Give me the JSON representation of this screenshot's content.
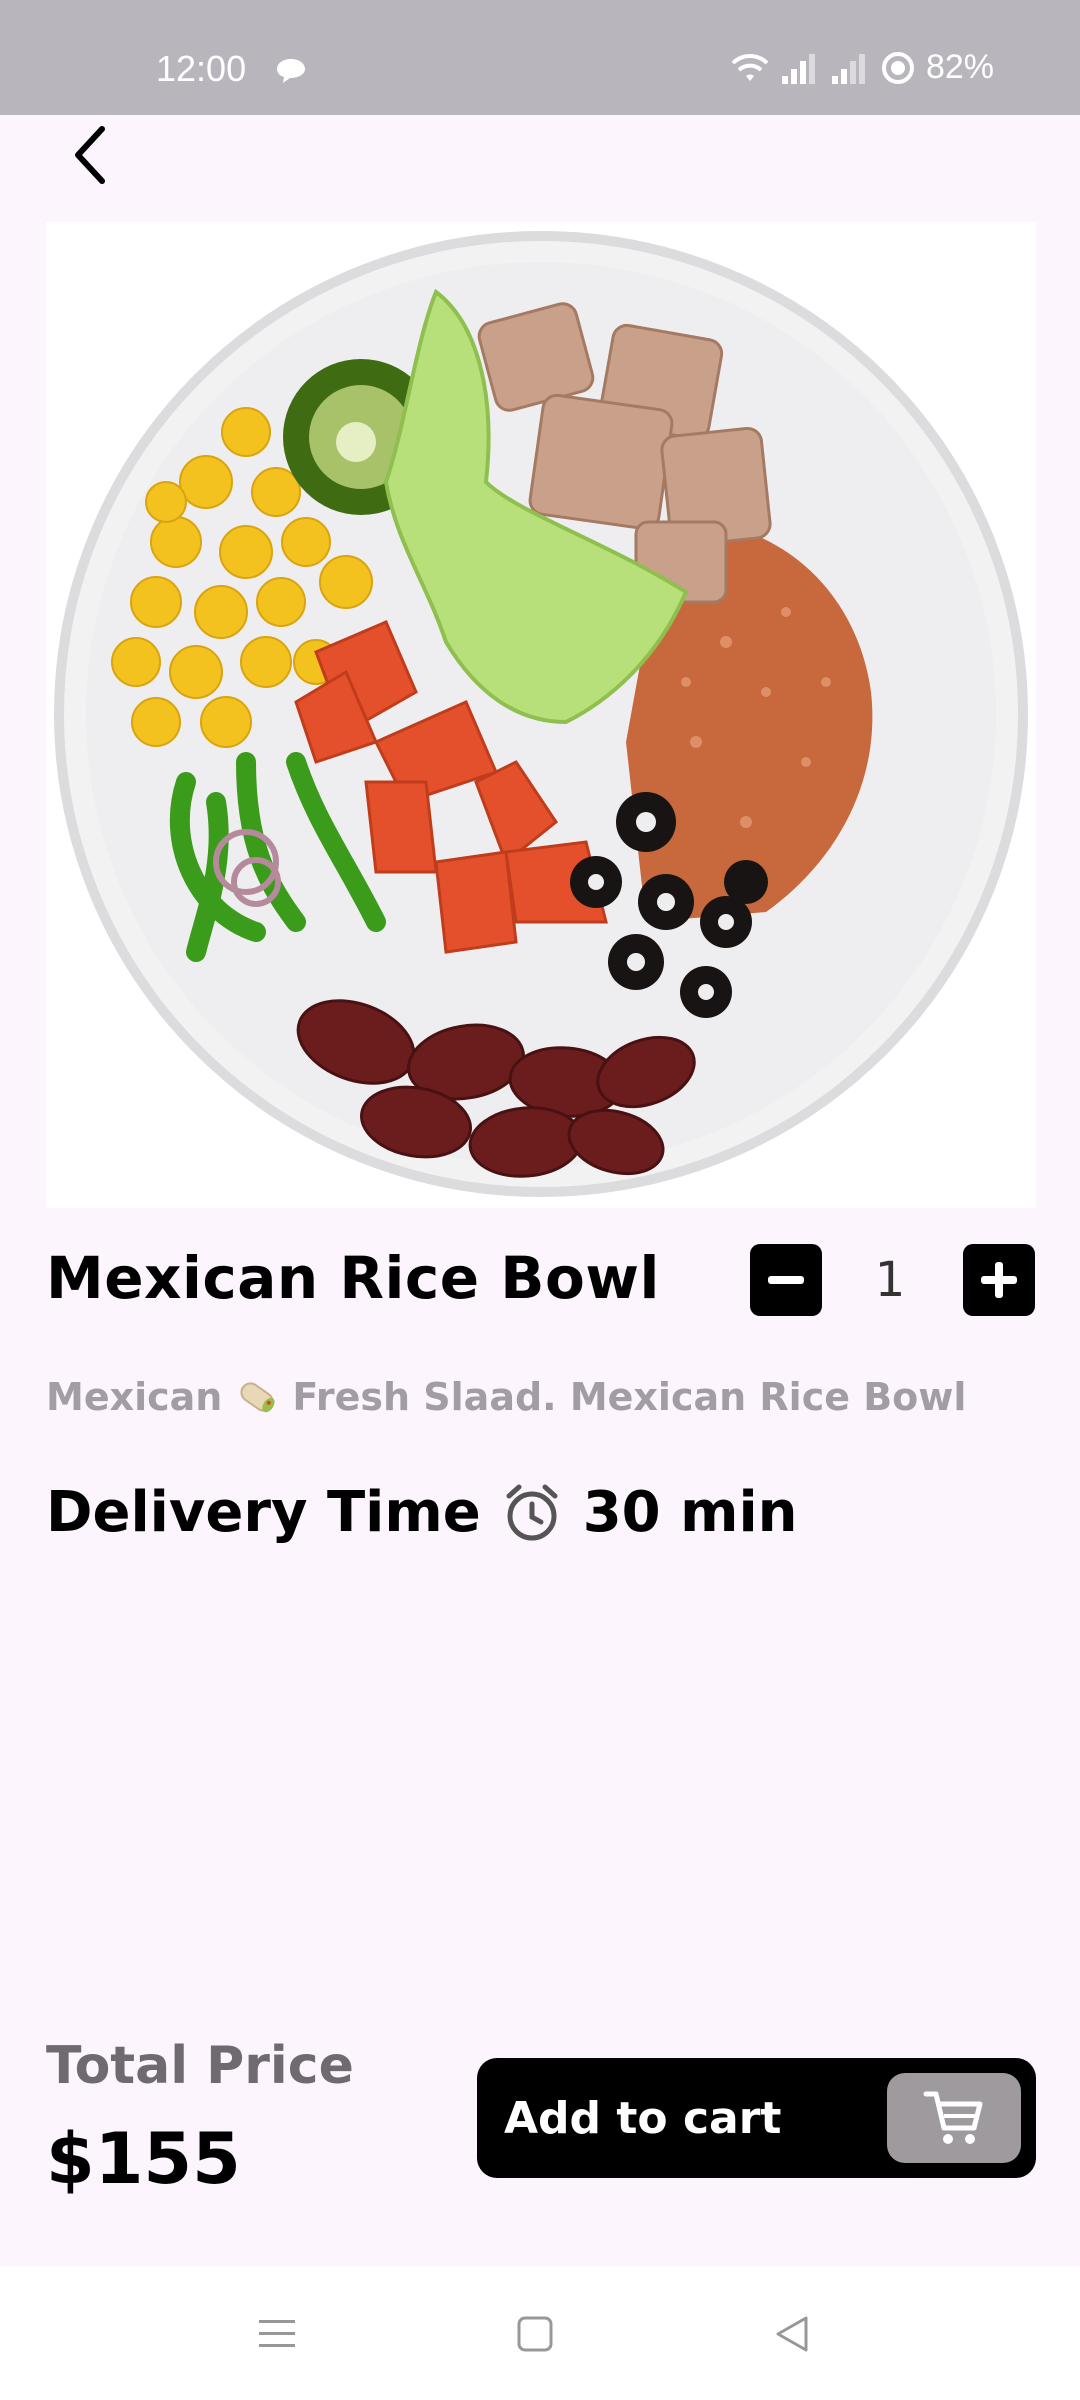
{
  "status_bar": {
    "time": "12:00",
    "battery": "82%"
  },
  "header": {
    "back_icon": "chevron-left-icon"
  },
  "product": {
    "image_alt": "bowl with rice, chicken, corn, jalapeños, lettuce, tomatoes, olives and kidney beans",
    "title": "Mexican Rice Bowl",
    "quantity": "1",
    "description_prefix": "Mexican",
    "description_icon": "burrito-icon",
    "description_suffix": "Fresh Slaad. Mexican Rice Bowl",
    "delivery_label": "Delivery Time",
    "delivery_icon": "alarm-clock-icon",
    "delivery_value": "30 min"
  },
  "footer": {
    "total_label": "Total Price",
    "total_value": "$155",
    "add_to_cart_label": "Add to cart",
    "cart_icon": "shopping-cart-icon"
  },
  "nav": {
    "items": [
      "menu-icon",
      "home-square-icon",
      "back-triangle-icon"
    ]
  },
  "colors": {
    "background": "#fcf5fd",
    "status_bar": "#b9b5bc",
    "primary": "#000000",
    "muted_text": "#a29ca4",
    "total_label": "#6f6a70",
    "cart_chip": "#9e9a9e"
  }
}
